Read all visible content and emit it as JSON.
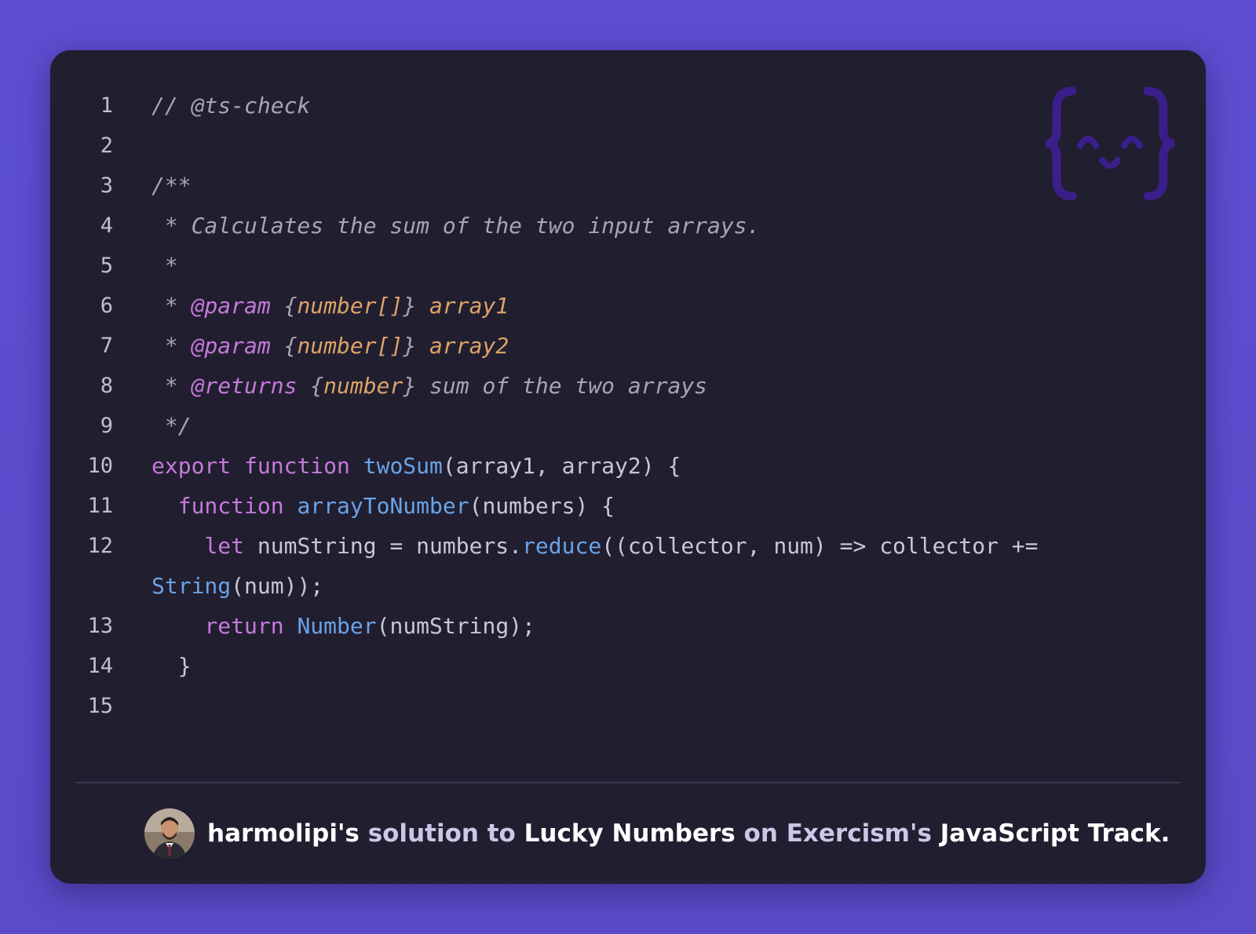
{
  "code": {
    "lines": [
      {
        "n": "1",
        "tokens": [
          {
            "t": "// @ts-check",
            "c": "comment"
          }
        ]
      },
      {
        "n": "2",
        "tokens": []
      },
      {
        "n": "3",
        "tokens": [
          {
            "t": "/**",
            "c": "comment"
          }
        ]
      },
      {
        "n": "4",
        "tokens": [
          {
            "t": " * Calculates the sum of the two input arrays.",
            "c": "comment"
          }
        ]
      },
      {
        "n": "5",
        "tokens": [
          {
            "t": " *",
            "c": "comment"
          }
        ]
      },
      {
        "n": "6",
        "tokens": [
          {
            "t": " * ",
            "c": "comment"
          },
          {
            "t": "@param",
            "c": "tag"
          },
          {
            "t": " {",
            "c": "comment"
          },
          {
            "t": "number[]",
            "c": "type"
          },
          {
            "t": "} ",
            "c": "comment"
          },
          {
            "t": "array1",
            "c": "param"
          }
        ]
      },
      {
        "n": "7",
        "tokens": [
          {
            "t": " * ",
            "c": "comment"
          },
          {
            "t": "@param",
            "c": "tag"
          },
          {
            "t": " {",
            "c": "comment"
          },
          {
            "t": "number[]",
            "c": "type"
          },
          {
            "t": "} ",
            "c": "comment"
          },
          {
            "t": "array2",
            "c": "param"
          }
        ]
      },
      {
        "n": "8",
        "tokens": [
          {
            "t": " * ",
            "c": "comment"
          },
          {
            "t": "@returns",
            "c": "tag"
          },
          {
            "t": " {",
            "c": "comment"
          },
          {
            "t": "number",
            "c": "type"
          },
          {
            "t": "} sum of the two arrays",
            "c": "comment"
          }
        ]
      },
      {
        "n": "9",
        "tokens": [
          {
            "t": " */",
            "c": "comment"
          }
        ]
      },
      {
        "n": "10",
        "tokens": [
          {
            "t": "export",
            "c": "kw"
          },
          {
            "t": " ",
            "c": "plain"
          },
          {
            "t": "function",
            "c": "kw"
          },
          {
            "t": " ",
            "c": "plain"
          },
          {
            "t": "twoSum",
            "c": "fn"
          },
          {
            "t": "(array1, array2) {",
            "c": "plain"
          }
        ]
      },
      {
        "n": "11",
        "tokens": [
          {
            "t": "  ",
            "c": "plain"
          },
          {
            "t": "function",
            "c": "kw"
          },
          {
            "t": " ",
            "c": "plain"
          },
          {
            "t": "arrayToNumber",
            "c": "fn"
          },
          {
            "t": "(numbers) {",
            "c": "plain"
          }
        ]
      },
      {
        "n": "12",
        "tall": true,
        "tokens": [
          {
            "t": "    ",
            "c": "plain"
          },
          {
            "t": "let",
            "c": "kw"
          },
          {
            "t": " numString = numbers.",
            "c": "plain"
          },
          {
            "t": "reduce",
            "c": "fn"
          },
          {
            "t": "((collector, num) => collector += ",
            "c": "plain"
          },
          {
            "t": "String",
            "c": "fn"
          },
          {
            "t": "(num));",
            "c": "plain"
          }
        ]
      },
      {
        "n": "13",
        "tokens": [
          {
            "t": "    ",
            "c": "plain"
          },
          {
            "t": "return",
            "c": "kw"
          },
          {
            "t": " ",
            "c": "plain"
          },
          {
            "t": "Number",
            "c": "fn"
          },
          {
            "t": "(numString);",
            "c": "plain"
          }
        ]
      },
      {
        "n": "14",
        "tokens": [
          {
            "t": "  }",
            "c": "plain"
          }
        ]
      },
      {
        "n": "15",
        "tokens": []
      }
    ]
  },
  "footer": {
    "author": "harmolipi's",
    "solution_to": "solution to",
    "exercise": "Lucky Numbers",
    "on": "on",
    "site": "Exercism's",
    "track": "JavaScript Track."
  },
  "colors": {
    "background": "#5d4ed1",
    "card": "#211e30",
    "keyword": "#c47ad9",
    "function": "#6aa3e6",
    "type": "#dba367",
    "comment": "#a6a4b5"
  },
  "icons": {
    "logo": "exercism-logo-icon",
    "avatar": "user-avatar"
  }
}
